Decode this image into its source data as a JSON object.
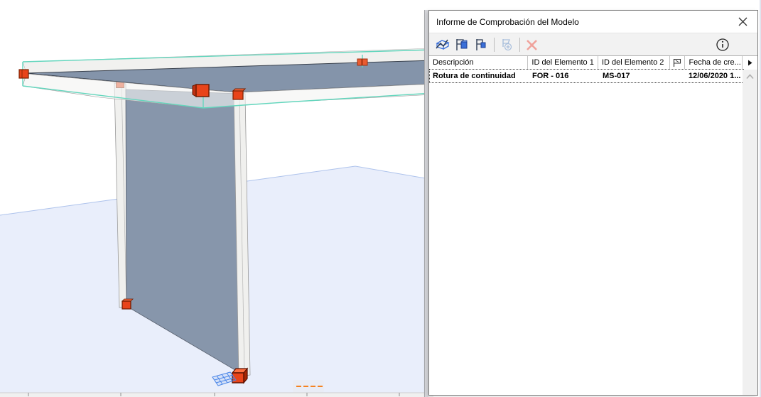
{
  "colors": {
    "selection_teal": "#63d6bd",
    "marker_red": "#e8441a",
    "marker_red_dark": "#7a2000",
    "slab_top": "#8494aa",
    "wall_face": "#8796ab",
    "white_face": "#f1f1ef",
    "ground": "#e9eefb",
    "ground_edge": "#aec3ec",
    "icon_blue": "#3a6fd8",
    "disabled_red": "#f0a29b",
    "grid_blue": "#4a86e8",
    "dash_orange": "#f5821f"
  },
  "panel": {
    "title": "Informe de Comprobación del Modelo",
    "toolbar": {
      "icons": [
        {
          "name": "zoom-to-conflict-3d",
          "enabled": true
        },
        {
          "name": "flag-both-elements",
          "enabled": true
        },
        {
          "name": "flag-element",
          "enabled": true
        },
        {
          "name": "add-flag",
          "enabled": false
        },
        {
          "name": "delete-entry",
          "enabled": false
        },
        {
          "name": "info",
          "enabled": true
        }
      ]
    },
    "table": {
      "columns": {
        "descripcion": "Descripción",
        "id_elemento_1": "ID del Elemento 1",
        "id_elemento_2": "ID del Elemento 2",
        "flag": "",
        "fecha": "Fecha de cre..."
      },
      "rows": [
        {
          "descripcion": "Rotura de continuidad",
          "id_elemento_1": "FOR - 016",
          "id_elemento_2": "MS-017",
          "flag": "",
          "fecha": "12/06/2020 1..."
        }
      ]
    }
  },
  "viewport": {
    "elements": [
      "slab FOR - 016 (selected, teal outline)",
      "wall MS-017",
      "ground plane"
    ],
    "markers": [
      "clash-marker-left-tip",
      "clash-marker-column-top",
      "clash-marker-main",
      "clash-marker-secondary",
      "clash-marker-slab-edge",
      "clash-marker-column-base",
      "clash-marker-wall-base",
      "origin-grid"
    ],
    "minimized_palette_dashes": "----"
  }
}
